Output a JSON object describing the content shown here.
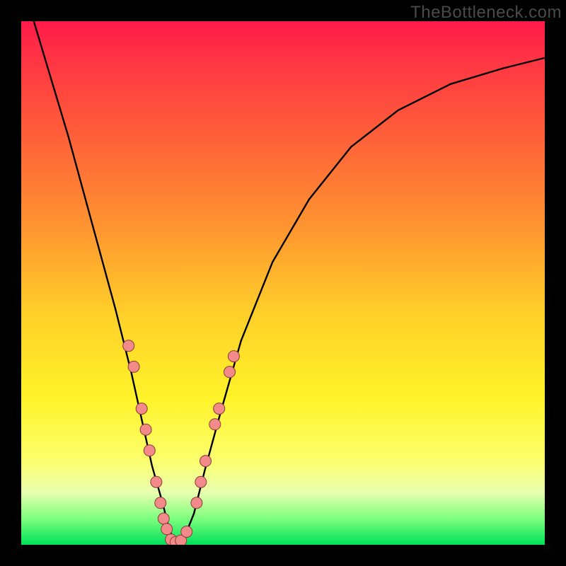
{
  "watermark": "TheBottleneck.com",
  "colors": {
    "frame": "#000000",
    "gradient_top": "#ff1a49",
    "gradient_mid": "#ffd029",
    "gradient_bottom": "#00e05b",
    "curve": "#000000",
    "dot_fill": "#f28a8a",
    "dot_stroke": "#8a3a3a"
  },
  "chart_data": {
    "type": "line",
    "title": "",
    "xlabel": "",
    "ylabel": "",
    "xlim": [
      0,
      100
    ],
    "ylim": [
      0,
      100
    ],
    "grid": false,
    "legend": false,
    "series": [
      {
        "name": "bottleneck-curve",
        "x": [
          0,
          3,
          6,
          9,
          12,
          15,
          18,
          21,
          23,
          25,
          27,
          28,
          29,
          30,
          31,
          33,
          35,
          38,
          42,
          48,
          55,
          63,
          72,
          82,
          92,
          100
        ],
        "y": [
          108,
          98,
          88,
          78,
          67,
          56,
          45,
          33,
          24,
          15,
          8,
          4,
          1,
          0.5,
          1,
          6,
          14,
          25,
          39,
          54,
          66,
          76,
          83,
          88,
          91,
          93
        ]
      }
    ],
    "scatter_points": {
      "name": "marked-points",
      "points": [
        {
          "x": 20.5,
          "y": 38
        },
        {
          "x": 21.5,
          "y": 34
        },
        {
          "x": 23.0,
          "y": 26
        },
        {
          "x": 23.8,
          "y": 22
        },
        {
          "x": 24.5,
          "y": 18
        },
        {
          "x": 25.8,
          "y": 12
        },
        {
          "x": 26.6,
          "y": 8
        },
        {
          "x": 27.2,
          "y": 5
        },
        {
          "x": 27.8,
          "y": 3
        },
        {
          "x": 28.6,
          "y": 1
        },
        {
          "x": 29.5,
          "y": 0.5
        },
        {
          "x": 30.5,
          "y": 0.8
        },
        {
          "x": 31.6,
          "y": 2.5
        },
        {
          "x": 33.5,
          "y": 8
        },
        {
          "x": 34.3,
          "y": 12
        },
        {
          "x": 35.2,
          "y": 16
        },
        {
          "x": 37.0,
          "y": 23
        },
        {
          "x": 37.8,
          "y": 26
        },
        {
          "x": 39.8,
          "y": 33
        },
        {
          "x": 40.6,
          "y": 36
        }
      ]
    }
  }
}
